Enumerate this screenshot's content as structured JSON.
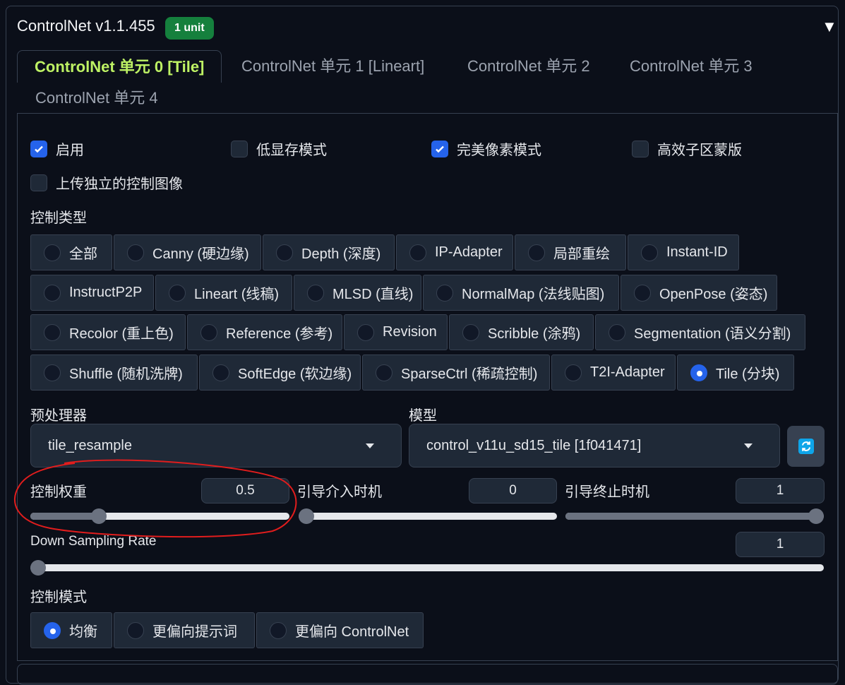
{
  "header": {
    "title": "ControlNet v1.1.455",
    "badge": "1 unit",
    "collapse_icon": "▼"
  },
  "tabs": [
    {
      "label": "ControlNet 单元 0 [Tile]",
      "active": true
    },
    {
      "label": "ControlNet 单元 1 [Lineart]",
      "active": false
    },
    {
      "label": "ControlNet 单元 2",
      "active": false
    },
    {
      "label": "ControlNet 单元 3",
      "active": false
    },
    {
      "label": "ControlNet 单元 4",
      "active": false
    }
  ],
  "checkboxes": [
    {
      "label": "启用",
      "checked": true
    },
    {
      "label": "低显存模式",
      "checked": false
    },
    {
      "label": "完美像素模式",
      "checked": true
    },
    {
      "label": "高效子区蒙版",
      "checked": false
    },
    {
      "label": "上传独立的控制图像",
      "checked": false
    }
  ],
  "control_type": {
    "label": "控制类型",
    "options": [
      "全部",
      "Canny (硬边缘)",
      "Depth (深度)",
      "IP-Adapter",
      "局部重绘",
      "Instant-ID",
      "InstructP2P",
      "Lineart (线稿)",
      "MLSD (直线)",
      "NormalMap (法线贴图)",
      "OpenPose (姿态)",
      "Recolor (重上色)",
      "Reference (参考)",
      "Revision",
      "Scribble (涂鸦)",
      "Segmentation (语义分割)",
      "Shuffle (随机洗牌)",
      "SoftEdge (软边缘)",
      "SparseCtrl (稀疏控制)",
      "T2I-Adapter",
      "Tile (分块)"
    ],
    "selected": "Tile (分块)"
  },
  "preprocessor": {
    "label": "预处理器",
    "value": "tile_resample"
  },
  "model": {
    "label": "模型",
    "value": "control_v11u_sd15_tile [1f041471]",
    "refresh_icon": "refresh-icon"
  },
  "sliders": {
    "weight": {
      "label": "控制权重",
      "value": "0.5",
      "fraction": 0.25
    },
    "start": {
      "label": "引导介入时机",
      "value": "0",
      "fraction": 0.0
    },
    "end": {
      "label": "引导终止时机",
      "value": "1",
      "fraction": 1.0
    },
    "downsample": {
      "label": "Down Sampling Rate",
      "value": "1",
      "fraction": 0.0
    }
  },
  "control_mode": {
    "label": "控制模式",
    "options": [
      "均衡",
      "更偏向提示词",
      "更偏向 ControlNet"
    ],
    "selected": "均衡"
  },
  "colors": {
    "accent_blue": "#2563eb",
    "active_tab": "#bef264",
    "badge_green": "#15803d",
    "annotation_red": "#e11d1d"
  }
}
